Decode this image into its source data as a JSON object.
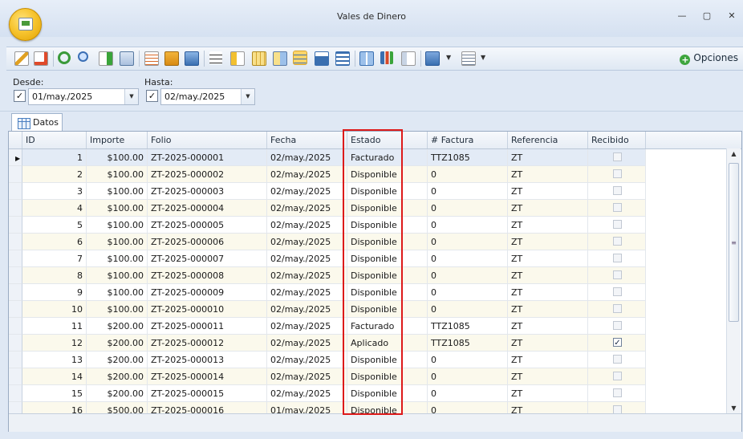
{
  "window": {
    "title": "Vales de Dinero",
    "minimize": "—",
    "restore": "▢",
    "close": "✕"
  },
  "toolbar": {
    "options_label": "Opciones",
    "icons": [
      "edit-icon",
      "new-document-icon",
      "refresh-icon",
      "search-icon",
      "export-icon",
      "send-icon",
      "table-properties-icon",
      "table-edit-icon",
      "table-link-icon",
      "align-icon",
      "group-icon",
      "column-chooser-icon",
      "layout-icon",
      "grid-view-icon",
      "card-view-icon",
      "band-view-icon",
      "tile-view-icon",
      "bar-chart-icon",
      "id-card-icon",
      "print-preview-icon",
      "report-icon"
    ]
  },
  "filter": {
    "desde_label": "Desde:",
    "desde_value": "01/may./2025",
    "hasta_label": "Hasta:",
    "hasta_value": "02/may./2025"
  },
  "tabs": [
    {
      "label": "Datos"
    }
  ],
  "grid": {
    "columns": [
      "ID",
      "Importe",
      "Folio",
      "Fecha",
      "Estado",
      "# Factura",
      "Referencia",
      "Recibido"
    ],
    "rows": [
      {
        "id": "1",
        "importe": "$100.00",
        "folio": "ZT-2025-000001",
        "fecha": "02/may./2025",
        "estado": "Facturado",
        "factura": "TTZ1085",
        "referencia": "ZT",
        "recibido": false
      },
      {
        "id": "2",
        "importe": "$100.00",
        "folio": "ZT-2025-000002",
        "fecha": "02/may./2025",
        "estado": "Disponible",
        "factura": "0",
        "referencia": "ZT",
        "recibido": false
      },
      {
        "id": "3",
        "importe": "$100.00",
        "folio": "ZT-2025-000003",
        "fecha": "02/may./2025",
        "estado": "Disponible",
        "factura": "0",
        "referencia": "ZT",
        "recibido": false
      },
      {
        "id": "4",
        "importe": "$100.00",
        "folio": "ZT-2025-000004",
        "fecha": "02/may./2025",
        "estado": "Disponible",
        "factura": "0",
        "referencia": "ZT",
        "recibido": false
      },
      {
        "id": "5",
        "importe": "$100.00",
        "folio": "ZT-2025-000005",
        "fecha": "02/may./2025",
        "estado": "Disponible",
        "factura": "0",
        "referencia": "ZT",
        "recibido": false
      },
      {
        "id": "6",
        "importe": "$100.00",
        "folio": "ZT-2025-000006",
        "fecha": "02/may./2025",
        "estado": "Disponible",
        "factura": "0",
        "referencia": "ZT",
        "recibido": false
      },
      {
        "id": "7",
        "importe": "$100.00",
        "folio": "ZT-2025-000007",
        "fecha": "02/may./2025",
        "estado": "Disponible",
        "factura": "0",
        "referencia": "ZT",
        "recibido": false
      },
      {
        "id": "8",
        "importe": "$100.00",
        "folio": "ZT-2025-000008",
        "fecha": "02/may./2025",
        "estado": "Disponible",
        "factura": "0",
        "referencia": "ZT",
        "recibido": false
      },
      {
        "id": "9",
        "importe": "$100.00",
        "folio": "ZT-2025-000009",
        "fecha": "02/may./2025",
        "estado": "Disponible",
        "factura": "0",
        "referencia": "ZT",
        "recibido": false
      },
      {
        "id": "10",
        "importe": "$100.00",
        "folio": "ZT-2025-000010",
        "fecha": "02/may./2025",
        "estado": "Disponible",
        "factura": "0",
        "referencia": "ZT",
        "recibido": false
      },
      {
        "id": "11",
        "importe": "$200.00",
        "folio": "ZT-2025-000011",
        "fecha": "02/may./2025",
        "estado": "Facturado",
        "factura": "TTZ1085",
        "referencia": "ZT",
        "recibido": false
      },
      {
        "id": "12",
        "importe": "$200.00",
        "folio": "ZT-2025-000012",
        "fecha": "02/may./2025",
        "estado": "Aplicado",
        "factura": "TTZ1085",
        "referencia": "ZT",
        "recibido": true
      },
      {
        "id": "13",
        "importe": "$200.00",
        "folio": "ZT-2025-000013",
        "fecha": "02/may./2025",
        "estado": "Disponible",
        "factura": "0",
        "referencia": "ZT",
        "recibido": false
      },
      {
        "id": "14",
        "importe": "$200.00",
        "folio": "ZT-2025-000014",
        "fecha": "02/may./2025",
        "estado": "Disponible",
        "factura": "0",
        "referencia": "ZT",
        "recibido": false
      },
      {
        "id": "15",
        "importe": "$200.00",
        "folio": "ZT-2025-000015",
        "fecha": "02/may./2025",
        "estado": "Disponible",
        "factura": "0",
        "referencia": "ZT",
        "recibido": false
      },
      {
        "id": "16",
        "importe": "$500.00",
        "folio": "ZT-2025-000016",
        "fecha": "01/may./2025",
        "estado": "Disponible",
        "factura": "0",
        "referencia": "ZT",
        "recibido": false
      }
    ]
  },
  "colors": {
    "highlight": "#dd1a1a",
    "accent": "#f7c531"
  }
}
